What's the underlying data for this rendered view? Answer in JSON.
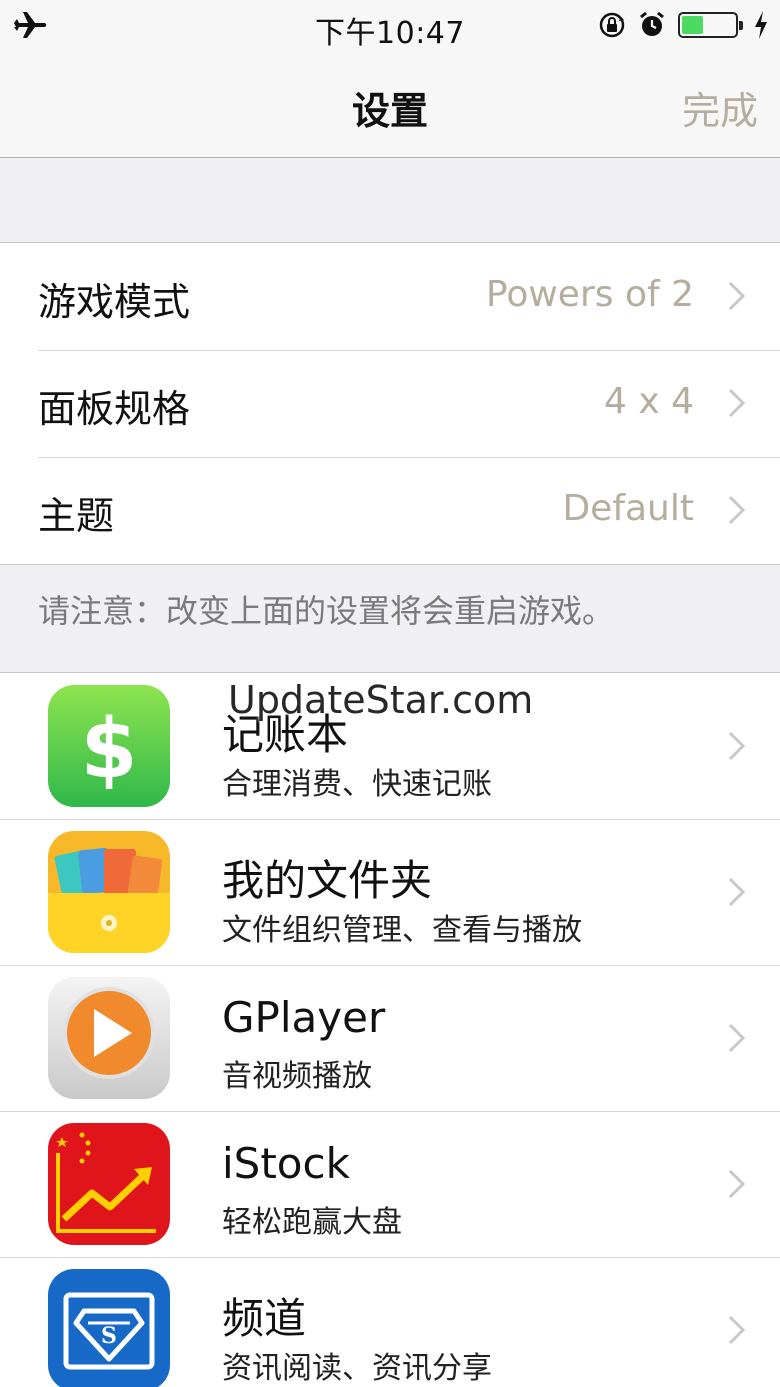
{
  "status_bar": {
    "time": "下午10:47",
    "battery_level": 0.4,
    "battery_color": "#4cd964"
  },
  "nav": {
    "title": "设置",
    "done_label": "完成"
  },
  "settings": [
    {
      "label": "游戏模式",
      "value": "Powers of 2"
    },
    {
      "label": "面板规格",
      "value": "4 x 4"
    },
    {
      "label": "主题",
      "value": "Default"
    }
  ],
  "note": "请注意：改变上面的设置将会重启游戏。",
  "apps": [
    {
      "name": "记账本",
      "desc": "合理消费、快速记账",
      "icon": "dollar-icon"
    },
    {
      "name": "我的文件夹",
      "desc": "文件组织管理、查看与播放",
      "icon": "folder-icon"
    },
    {
      "name": "GPlayer",
      "desc": "音视频播放",
      "icon": "play-icon"
    },
    {
      "name": "iStock",
      "desc": "轻松跑赢大盘",
      "icon": "stock-chart-icon"
    },
    {
      "name": "频道",
      "desc": "资讯阅读、资讯分享",
      "icon": "shield-s-icon"
    }
  ],
  "watermark": "UpdateStar.com",
  "colors": {
    "accent_value": "#b5ad9d",
    "background": "#efeff4"
  }
}
